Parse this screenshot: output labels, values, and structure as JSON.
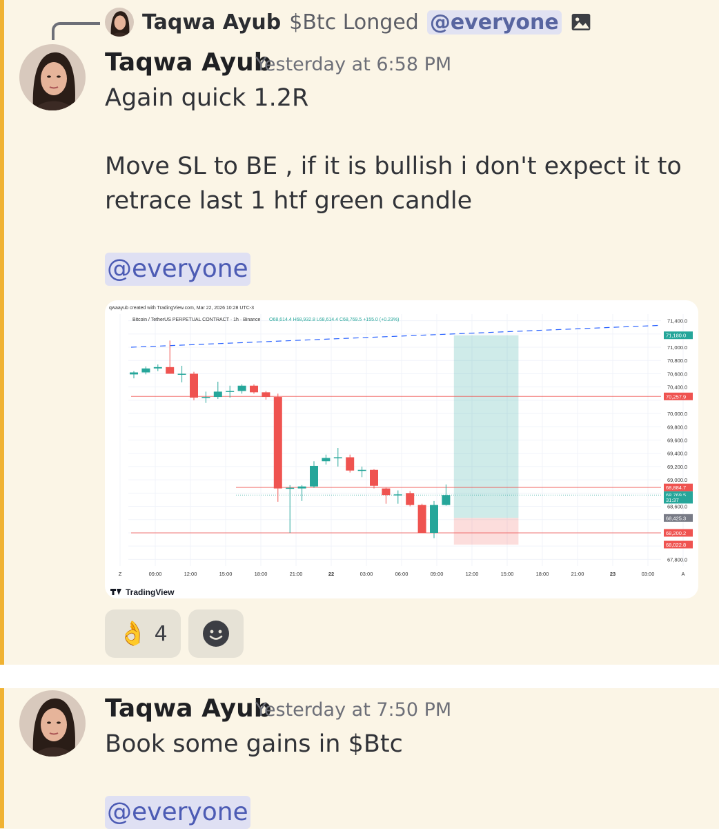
{
  "reply_ref": {
    "author": "Taqwa Ayub",
    "text": "$Btc Longed",
    "mention": "@everyone",
    "attachment_icon": "image-icon"
  },
  "messages": [
    {
      "author": "Taqwa Ayub",
      "timestamp": "Yesterday at 6:58 PM",
      "lines": [
        "Again quick 1.2R",
        "Move SL to BE , if it is bullish i don't expect it to",
        "retrace last 1 htf green candle"
      ],
      "mention": "@everyone",
      "reactions": [
        {
          "emoji": "👌",
          "count": "4"
        },
        {
          "emoji": "add-reaction-icon",
          "count": ""
        }
      ]
    },
    {
      "author": "Taqwa Ayub",
      "timestamp": "Yesterday at 7:50 PM",
      "lines": [
        "Book some gains in $Btc"
      ],
      "mention": "@everyone"
    }
  ],
  "chart_meta": {
    "created": "qwaayub created with TradingView.com, Mar 22, 2026 10:28 UTC-3",
    "symbol": "Bitcoin / TetherUS PERPETUAL CONTRACT · 1h · Binance",
    "ohlc": "O68,614.4 H68,932.8 L68,614.4 C68,769.5 +155.0 (+0.23%)",
    "brand": "TradingView"
  },
  "colors": {
    "up": "#26a69a",
    "down": "#ef5350",
    "accent_bar": "#f0b232",
    "mention": "#4c5bb4"
  },
  "chart_data": {
    "type": "candlestick",
    "ylim": [
      67700,
      71500
    ],
    "y_ticks": [
      "71,400.0",
      "71,000.0",
      "70,800.0",
      "70,600.0",
      "70,400.0",
      "70,000.0",
      "69,800.0",
      "69,600.0",
      "69,400.0",
      "69,200.0",
      "69,000.0",
      "68,600.0",
      "67,800.0"
    ],
    "x_ticks": [
      "Z",
      "09:00",
      "12:00",
      "15:00",
      "18:00",
      "21:00",
      "22",
      "03:00",
      "06:00",
      "09:00",
      "12:00",
      "15:00",
      "18:00",
      "21:00",
      "23",
      "03:00",
      "A"
    ],
    "price_labels": [
      {
        "text": "71,180.0",
        "value": 71180,
        "color": "#26a69a"
      },
      {
        "text": "70,257.9",
        "value": 70258,
        "color": "#ef5350"
      },
      {
        "text": "68,884.7",
        "value": 68885,
        "color": "#ef5350"
      },
      {
        "text": "68,769.5",
        "value": 68770,
        "color": "#26a69a"
      },
      {
        "text": "31:37",
        "value": 68700,
        "color": "#26a69a"
      },
      {
        "text": "68,425.3",
        "value": 68425,
        "color": "#787b86"
      },
      {
        "text": "68,200.2",
        "value": 68200,
        "color": "#ef5350"
      },
      {
        "text": "68,022.8",
        "value": 68023,
        "color": "#ef5350"
      }
    ],
    "horizontal_lines": [
      {
        "value": 70258,
        "color": "#ef5350",
        "style": "solid"
      },
      {
        "value": 68885,
        "color": "#ef5350",
        "style": "solid"
      },
      {
        "value": 68770,
        "color": "#26a69a",
        "style": "dotted"
      },
      {
        "value": 68200,
        "color": "#ef5350",
        "style": "solid"
      }
    ],
    "trendline": {
      "from": [
        0,
        71000
      ],
      "to": [
        46,
        71330
      ],
      "color": "#2962ff",
      "style": "dashed"
    },
    "position": {
      "entry": 68425,
      "target": 71180,
      "stop": 68023,
      "start_index": 27,
      "end_index": 31
    },
    "candles": [
      {
        "o": 70590,
        "h": 70640,
        "l": 70530,
        "c": 70620
      },
      {
        "o": 70620,
        "h": 70710,
        "l": 70590,
        "c": 70680
      },
      {
        "o": 70680,
        "h": 70740,
        "l": 70640,
        "c": 70700
      },
      {
        "o": 70700,
        "h": 71100,
        "l": 70600,
        "c": 70600
      },
      {
        "o": 70600,
        "h": 70720,
        "l": 70470,
        "c": 70600
      },
      {
        "o": 70600,
        "h": 70630,
        "l": 70200,
        "c": 70240
      },
      {
        "o": 70240,
        "h": 70330,
        "l": 70160,
        "c": 70250
      },
      {
        "o": 70250,
        "h": 70480,
        "l": 70220,
        "c": 70330
      },
      {
        "o": 70330,
        "h": 70420,
        "l": 70240,
        "c": 70340
      },
      {
        "o": 70340,
        "h": 70440,
        "l": 70300,
        "c": 70420
      },
      {
        "o": 70420,
        "h": 70440,
        "l": 70300,
        "c": 70320
      },
      {
        "o": 70320,
        "h": 70340,
        "l": 70210,
        "c": 70250
      },
      {
        "o": 70250,
        "h": 70300,
        "l": 68670,
        "c": 68870
      },
      {
        "o": 68870,
        "h": 68920,
        "l": 68200,
        "c": 68880
      },
      {
        "o": 68870,
        "h": 68920,
        "l": 68680,
        "c": 68900
      },
      {
        "o": 68900,
        "h": 69280,
        "l": 68880,
        "c": 69210
      },
      {
        "o": 69280,
        "h": 69380,
        "l": 69230,
        "c": 69330
      },
      {
        "o": 69330,
        "h": 69480,
        "l": 69200,
        "c": 69340
      },
      {
        "o": 69340,
        "h": 69380,
        "l": 69110,
        "c": 69140
      },
      {
        "o": 69140,
        "h": 69200,
        "l": 69040,
        "c": 69150
      },
      {
        "o": 69150,
        "h": 69160,
        "l": 68870,
        "c": 68910
      },
      {
        "o": 68870,
        "h": 68880,
        "l": 68640,
        "c": 68770
      },
      {
        "o": 68770,
        "h": 68840,
        "l": 68640,
        "c": 68780
      },
      {
        "o": 68800,
        "h": 68830,
        "l": 68600,
        "c": 68620
      },
      {
        "o": 68620,
        "h": 68640,
        "l": 68200,
        "c": 68200
      },
      {
        "o": 68200,
        "h": 68680,
        "l": 68120,
        "c": 68620
      },
      {
        "o": 68620,
        "h": 68930,
        "l": 68610,
        "c": 68770
      }
    ]
  }
}
